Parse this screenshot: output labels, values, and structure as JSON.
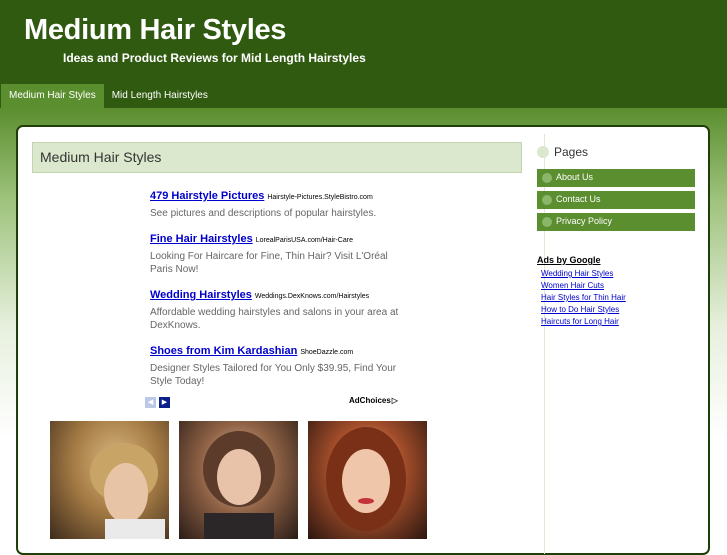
{
  "site": {
    "title": "Medium Hair Styles",
    "tagline": "Ideas and Product Reviews for Mid Length Hairstyles"
  },
  "nav": {
    "items": [
      {
        "label": "Medium Hair Styles",
        "active": true
      },
      {
        "label": "Mid Length Hairstyles",
        "active": false
      }
    ]
  },
  "content": {
    "title": "Medium Hair Styles",
    "ads": [
      {
        "title": "479 Hairstyle Pictures",
        "url": "Hairstyle-Pictures.StyleBistro.com",
        "desc": "See pictures and descriptions of popular hairstyles."
      },
      {
        "title": "Fine Hair Hairstyles",
        "url": "LorealParisUSA.com/Hair-Care",
        "desc": "Looking For Haircare for Fine, Thin Hair? Visit L'Oréal Paris Now!"
      },
      {
        "title": "Wedding Hairstyles",
        "url": "Weddings.DexKnows.com/Hairstyles",
        "desc": "Affordable wedding hairstyles and salons in your area at DexKnows."
      },
      {
        "title": "Shoes from Kim Kardashian",
        "url": "ShoeDazzle.com",
        "desc": "Designer Styles Tailored for You Only $39.95, Find Your Style Today!"
      }
    ],
    "adchoices_label": "AdChoices",
    "ad_prev_glyph": "◀",
    "ad_next_glyph": "▶",
    "adchoices_glyph": "▷"
  },
  "sidebar": {
    "pages_title": "Pages",
    "page_links": [
      {
        "label": "About Us"
      },
      {
        "label": "Contact Us"
      },
      {
        "label": "Privacy Policy"
      }
    ],
    "ads_title": "Ads by Google",
    "ads_links": [
      {
        "label": "Wedding Hair Styles"
      },
      {
        "label": "Women Hair Cuts"
      },
      {
        "label": "Hair Styles for Thin Hair"
      },
      {
        "label": "How to Do Hair Styles"
      },
      {
        "label": "Haircuts for Long Hair"
      }
    ]
  },
  "colors": {
    "header": "#2f5a10",
    "nav_active": "#5b8e2f",
    "link": "#0000cc",
    "title_bar": "#dbe8cd"
  }
}
